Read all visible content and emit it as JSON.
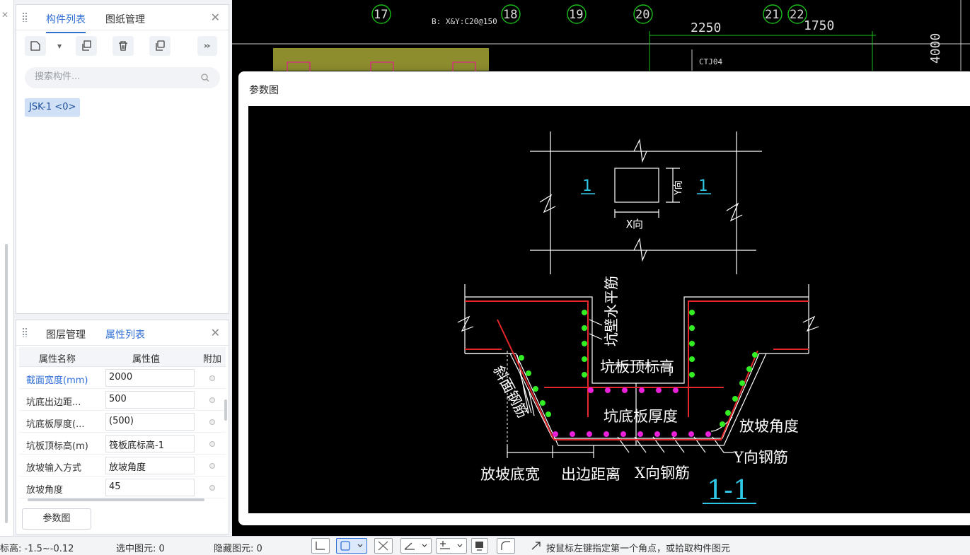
{
  "component_panel": {
    "tab_components": "构件列表",
    "tab_drawings": "图纸管理",
    "search_placeholder": "搜索构件...",
    "items": [
      {
        "label": "JSK-1 <0>"
      }
    ]
  },
  "property_panel": {
    "tab_layers": "图层管理",
    "tab_properties": "属性列表",
    "col_name": "属性名称",
    "col_value": "属性值",
    "col_extra": "附加",
    "rows": [
      {
        "name": "截面宽度(mm)",
        "value": "2000"
      },
      {
        "name": "坑底出边距...",
        "value": "500"
      },
      {
        "name": "坑底板厚度(...",
        "value": "(500)"
      },
      {
        "name": "坑板顶标高(m)",
        "value": "筏板底标高-1"
      },
      {
        "name": "放坡输入方式",
        "value": "放坡角度"
      },
      {
        "name": "放坡角度",
        "value": "45"
      }
    ],
    "param_button": "参数图"
  },
  "cad_background": {
    "axis_labels": [
      "17",
      "18",
      "19",
      "20",
      "21",
      "22"
    ],
    "rebar_note": "B: X&Y:C20@150",
    "dim_2250": "2250",
    "dim_1750": "1750",
    "dim_4000": "4000",
    "tag": "CTJ04"
  },
  "param_dialog": {
    "title": "参数图",
    "plan": {
      "section_mark_left": "1",
      "section_mark_right": "1",
      "y_dir": "Y向",
      "x_dir": "X向"
    },
    "section": {
      "wall_horizontal_rebar": "坑壁水平筋",
      "slab_top_elevation": "坑板顶标高",
      "slope_rebar": "斜面钢筋",
      "bottom_slab_thickness": "坑底板厚度",
      "slope_angle": "放坡角度",
      "y_rebar": "Y向钢筋",
      "slope_bottom_width": "放坡底宽",
      "edge_distance": "出边距离",
      "x_rebar": "X向钢筋",
      "section_title": "1-1"
    }
  },
  "status_bar": {
    "elevation": "标高: -1.5~-0.12",
    "selected": "选中图元: 0",
    "hidden": "隐藏图元: 0",
    "hint": "按鼠标左键指定第一个角点，或拾取构件图元"
  }
}
